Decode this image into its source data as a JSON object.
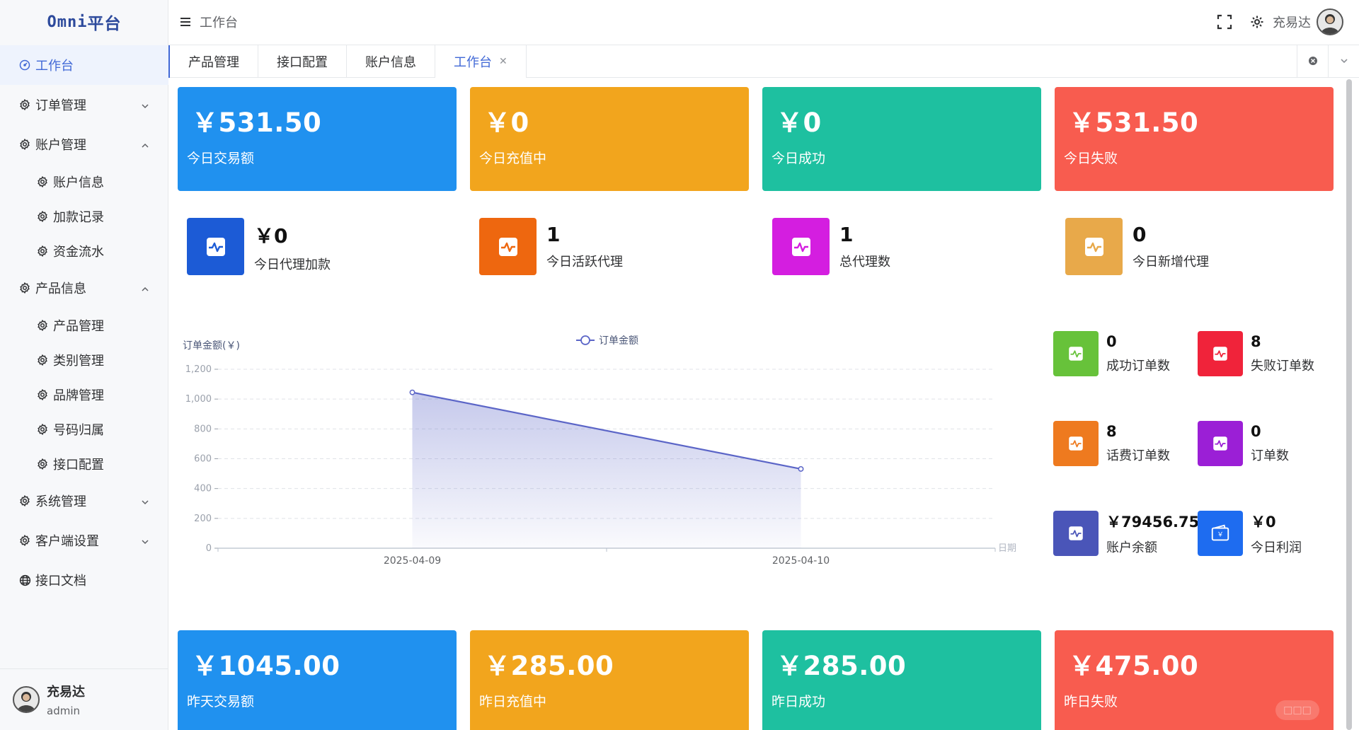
{
  "app": {
    "logo_prefix": "Omni",
    "logo_suffix": "平台"
  },
  "header": {
    "crumb": "工作台",
    "user_name": "充易达"
  },
  "sidebar": {
    "items": [
      {
        "label": "工作台",
        "icon": "dashboard-icon",
        "active": true,
        "type": "top"
      },
      {
        "label": "订单管理",
        "icon": "settings-icon",
        "type": "group",
        "expanded": false
      },
      {
        "label": "账户管理",
        "icon": "settings-icon",
        "type": "group",
        "expanded": true
      },
      {
        "label": "账户信息",
        "icon": "settings-icon",
        "type": "sub"
      },
      {
        "label": "加款记录",
        "icon": "settings-icon",
        "type": "sub"
      },
      {
        "label": "资金流水",
        "icon": "settings-icon",
        "type": "sub"
      },
      {
        "label": "产品信息",
        "icon": "settings-icon",
        "type": "group",
        "expanded": true
      },
      {
        "label": "产品管理",
        "icon": "settings-icon",
        "type": "sub"
      },
      {
        "label": "类别管理",
        "icon": "settings-icon",
        "type": "sub"
      },
      {
        "label": "品牌管理",
        "icon": "settings-icon",
        "type": "sub"
      },
      {
        "label": "号码归属",
        "icon": "settings-icon",
        "type": "sub"
      },
      {
        "label": "接口配置",
        "icon": "settings-icon",
        "type": "sub"
      },
      {
        "label": "系统管理",
        "icon": "settings-icon",
        "type": "group",
        "expanded": false
      },
      {
        "label": "客户端设置",
        "icon": "settings-icon",
        "type": "group",
        "expanded": false
      },
      {
        "label": "接口文档",
        "icon": "globe-icon",
        "type": "top"
      }
    ],
    "user": {
      "name": "充易达",
      "role": "admin"
    }
  },
  "tabs": [
    {
      "label": "产品管理"
    },
    {
      "label": "接口配置"
    },
    {
      "label": "账户信息"
    },
    {
      "label": "工作台",
      "active": true,
      "closable": true
    }
  ],
  "today_stats": [
    {
      "value": "￥531.50",
      "label": "今日交易额",
      "color": "#2091ef"
    },
    {
      "value": "￥0",
      "label": "今日充值中",
      "color": "#f2a51d"
    },
    {
      "value": "￥0",
      "label": "今日成功",
      "color": "#1ec0a0"
    },
    {
      "value": "￥531.50",
      "label": "今日失败",
      "color": "#f85c4f"
    }
  ],
  "agent_stats": [
    {
      "value": "￥0",
      "label": "今日代理加款",
      "color": "#1c5bd6"
    },
    {
      "value": "1",
      "label": "今日活跃代理",
      "color": "#ee670f"
    },
    {
      "value": "1",
      "label": "总代理数",
      "color": "#d41ee0"
    },
    {
      "value": "0",
      "label": "今日新增代理",
      "color": "#e8a94a"
    }
  ],
  "kpis": [
    {
      "value": "0",
      "label": "成功订单数",
      "color": "#67c23a",
      "icon": "pulse-icon"
    },
    {
      "value": "8",
      "label": "失败订单数",
      "color": "#f0233a",
      "icon": "pulse-icon"
    },
    {
      "value": "8",
      "label": "话费订单数",
      "color": "#ee7a1f",
      "icon": "pulse-icon"
    },
    {
      "value": "0",
      "label": "订单数",
      "color": "#9b1fd6",
      "icon": "pulse-icon"
    },
    {
      "value": "￥79456.75",
      "label": "账户余额",
      "color": "#4a55b8",
      "icon": "pulse-icon"
    },
    {
      "value": "￥0",
      "label": "今日利润",
      "color": "#1e6cf0",
      "icon": "wallet-icon"
    }
  ],
  "yesterday_stats": [
    {
      "value": "￥1045.00",
      "label": "昨天交易额",
      "color": "#2091ef"
    },
    {
      "value": "￥285.00",
      "label": "昨日充值中",
      "color": "#f2a51d"
    },
    {
      "value": "￥285.00",
      "label": "昨日成功",
      "color": "#1ec0a0"
    },
    {
      "value": "￥475.00",
      "label": "昨日失败",
      "color": "#f85c4f"
    }
  ],
  "chart_data": {
    "type": "area",
    "title": "",
    "legend": [
      "订单金额"
    ],
    "legend_position": "top-center",
    "xlabel": "日期",
    "ylabel": "订单金额(￥)",
    "categories": [
      "2025-04-09",
      "2025-04-10"
    ],
    "series": [
      {
        "name": "订单金额",
        "values": [
          1045,
          531.5
        ]
      }
    ],
    "yticks": [
      "0",
      "200",
      "400",
      "600",
      "800",
      "1,000",
      "1,200"
    ],
    "ylim": [
      0,
      1200
    ],
    "grid": true,
    "line_color": "#5b65c7"
  }
}
